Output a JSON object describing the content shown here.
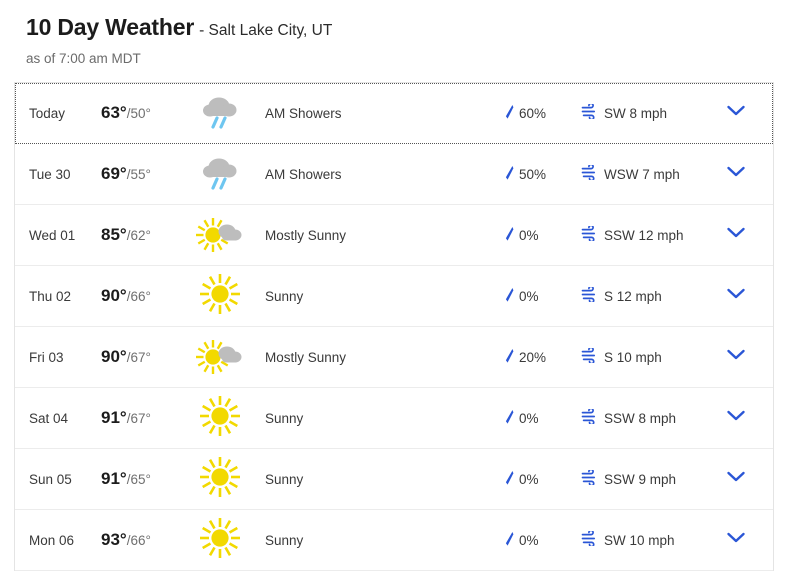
{
  "header": {
    "title": "10 Day Weather",
    "location": "- Salt Lake City, UT",
    "as_of": "as of 7:00 am MDT"
  },
  "colors": {
    "accent_blue": "#2a56d6",
    "rain_blue": "#6ec6f0",
    "sun_yellow": "#f2d900",
    "cloud_gray": "#bdbdbd",
    "text": "#3a3a3a",
    "muted": "#6b6b6b"
  },
  "icons": {
    "precip": "raindrop-icon",
    "wind": "wind-icon",
    "expand": "chevron-down-icon"
  },
  "forecast": {
    "rows": [
      {
        "day": "Today",
        "high": "63°",
        "low": "/50°",
        "condition": "AM Showers",
        "wx_icon": "rain-cloud-icon",
        "precip": "60%",
        "wind": "SW 8 mph",
        "focused": true
      },
      {
        "day": "Tue 30",
        "high": "69°",
        "low": "/55°",
        "condition": "AM Showers",
        "wx_icon": "rain-cloud-icon",
        "precip": "50%",
        "wind": "WSW 7 mph",
        "focused": false
      },
      {
        "day": "Wed 01",
        "high": "85°",
        "low": "/62°",
        "condition": "Mostly Sunny",
        "wx_icon": "sun-behind-cloud-icon",
        "precip": "0%",
        "wind": "SSW 12 mph",
        "focused": false
      },
      {
        "day": "Thu 02",
        "high": "90°",
        "low": "/66°",
        "condition": "Sunny",
        "wx_icon": "sun-icon",
        "precip": "0%",
        "wind": "S 12 mph",
        "focused": false
      },
      {
        "day": "Fri 03",
        "high": "90°",
        "low": "/67°",
        "condition": "Mostly Sunny",
        "wx_icon": "sun-behind-cloud-icon",
        "precip": "20%",
        "wind": "S 10 mph",
        "focused": false
      },
      {
        "day": "Sat 04",
        "high": "91°",
        "low": "/67°",
        "condition": "Sunny",
        "wx_icon": "sun-icon",
        "precip": "0%",
        "wind": "SSW 8 mph",
        "focused": false
      },
      {
        "day": "Sun 05",
        "high": "91°",
        "low": "/65°",
        "condition": "Sunny",
        "wx_icon": "sun-icon",
        "precip": "0%",
        "wind": "SSW 9 mph",
        "focused": false
      },
      {
        "day": "Mon 06",
        "high": "93°",
        "low": "/66°",
        "condition": "Sunny",
        "wx_icon": "sun-icon",
        "precip": "0%",
        "wind": "SW 10 mph",
        "focused": false
      }
    ]
  }
}
